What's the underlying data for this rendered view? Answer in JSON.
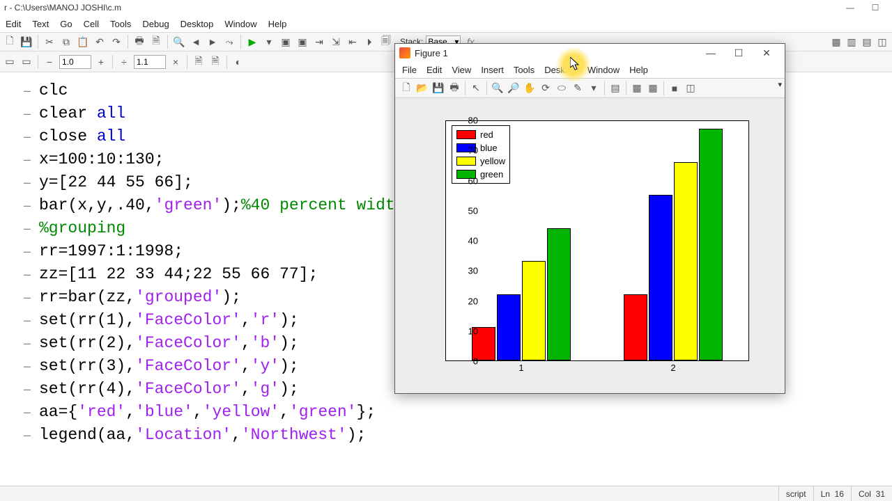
{
  "titlebar": {
    "path": "r - C:\\Users\\MANOJ JOSHI\\c.m"
  },
  "main_menu": [
    "Edit",
    "Text",
    "Go",
    "Cell",
    "Tools",
    "Debug",
    "Desktop",
    "Window",
    "Help"
  ],
  "toolbar2": {
    "box1": "1.0",
    "box2": "1.1",
    "stack_label": "Stack:",
    "stack_value": "Base",
    "fx": "fx"
  },
  "code_lines": [
    {
      "t": "clc"
    },
    {
      "t": "clear all",
      "kw": [
        "all"
      ]
    },
    {
      "t": "close all",
      "kw": [
        "all"
      ]
    },
    {
      "t": "x=100:10:130;"
    },
    {
      "t": "y=[22 44 55 66];"
    },
    {
      "t": "bar(x,y,.40,'green');%40 percent widt",
      "str": [
        "'green'"
      ],
      "cmt": "%40 percent widt"
    },
    {
      "t": "%grouping",
      "cmt": "%grouping"
    },
    {
      "t": "rr=1997:1:1998;"
    },
    {
      "t": "zz=[11 22 33 44;22 55 66 77];"
    },
    {
      "t": "rr=bar(zz,'grouped');",
      "str": [
        "'grouped'"
      ]
    },
    {
      "t": "set(rr(1),'FaceColor','r');",
      "str": [
        "'FaceColor'",
        "'r'"
      ]
    },
    {
      "t": "set(rr(2),'FaceColor','b');",
      "str": [
        "'FaceColor'",
        "'b'"
      ]
    },
    {
      "t": "set(rr(3),'FaceColor','y');",
      "str": [
        "'FaceColor'",
        "'y'"
      ]
    },
    {
      "t": "set(rr(4),'FaceColor','g');",
      "str": [
        "'FaceColor'",
        "'g'"
      ]
    },
    {
      "t": "aa={'red','blue','yellow','green'};",
      "str": [
        "'red'",
        "'blue'",
        "'yellow'",
        "'green'"
      ]
    },
    {
      "t": "legend(aa,'Location','Northwest');",
      "str": [
        "'Location'",
        "'Northwest'"
      ]
    }
  ],
  "statusbar": {
    "mode": "script",
    "ln_label": "Ln",
    "ln": "16",
    "col_label": "Col",
    "col": "31"
  },
  "figure": {
    "title": "Figure 1",
    "menu": [
      "File",
      "Edit",
      "View",
      "Insert",
      "Tools",
      "Desktop",
      "Window",
      "Help"
    ]
  },
  "legend_items": [
    {
      "label": "red",
      "color": "#ff0000"
    },
    {
      "label": "blue",
      "color": "#0000ff"
    },
    {
      "label": "yellow",
      "color": "#ffff00"
    },
    {
      "label": "green",
      "color": "#00b400"
    }
  ],
  "chart_data": {
    "type": "bar",
    "grouped": true,
    "categories": [
      "1",
      "2"
    ],
    "series": [
      {
        "name": "red",
        "color": "#ff0000",
        "values": [
          11,
          22
        ]
      },
      {
        "name": "blue",
        "color": "#0000ff",
        "values": [
          22,
          55
        ]
      },
      {
        "name": "yellow",
        "color": "#ffff00",
        "values": [
          33,
          66
        ]
      },
      {
        "name": "green",
        "color": "#00b400",
        "values": [
          44,
          77
        ]
      }
    ],
    "ylim": [
      0,
      80
    ],
    "yticks": [
      0,
      10,
      20,
      30,
      40,
      50,
      60,
      70,
      80
    ],
    "xlabel": "",
    "ylabel": "",
    "title": "",
    "legend_position": "northwest"
  }
}
